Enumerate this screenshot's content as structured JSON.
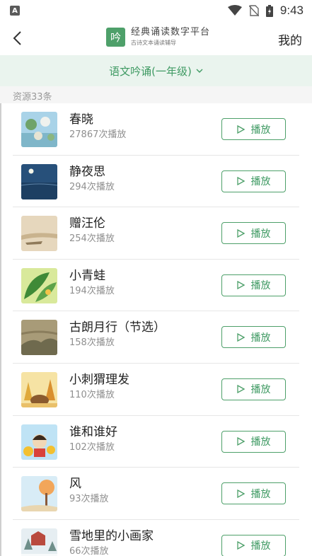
{
  "status_bar": {
    "time": "9:43",
    "app_badge": "A"
  },
  "header": {
    "brand_title": "经典诵读数字平台",
    "brand_subtitle": "古诗文本诵读辅导",
    "logo_glyph": "吟",
    "mine_label": "我的"
  },
  "grade_selector": {
    "label": "语文吟诵(一年级)"
  },
  "resource_count": "资源33条",
  "colors": {
    "accent": "#4ea06a",
    "grade_bg": "#eaf4ee"
  },
  "items": [
    {
      "title": "春晓",
      "plays": "27867次播放",
      "play_label": "播放"
    },
    {
      "title": "静夜思",
      "plays": "294次播放",
      "play_label": "播放"
    },
    {
      "title": "赠汪伦",
      "plays": "254次播放",
      "play_label": "播放"
    },
    {
      "title": "小青蛙",
      "plays": "194次播放",
      "play_label": "播放"
    },
    {
      "title": "古朗月行（节选）",
      "plays": "158次播放",
      "play_label": "播放"
    },
    {
      "title": "小刺猬理发",
      "plays": "110次播放",
      "play_label": "播放"
    },
    {
      "title": "谁和谁好",
      "plays": "102次播放",
      "play_label": "播放"
    },
    {
      "title": "风",
      "plays": "93次播放",
      "play_label": "播放"
    },
    {
      "title": "雪地里的小画家",
      "plays": "66次播放",
      "play_label": "播放"
    }
  ]
}
